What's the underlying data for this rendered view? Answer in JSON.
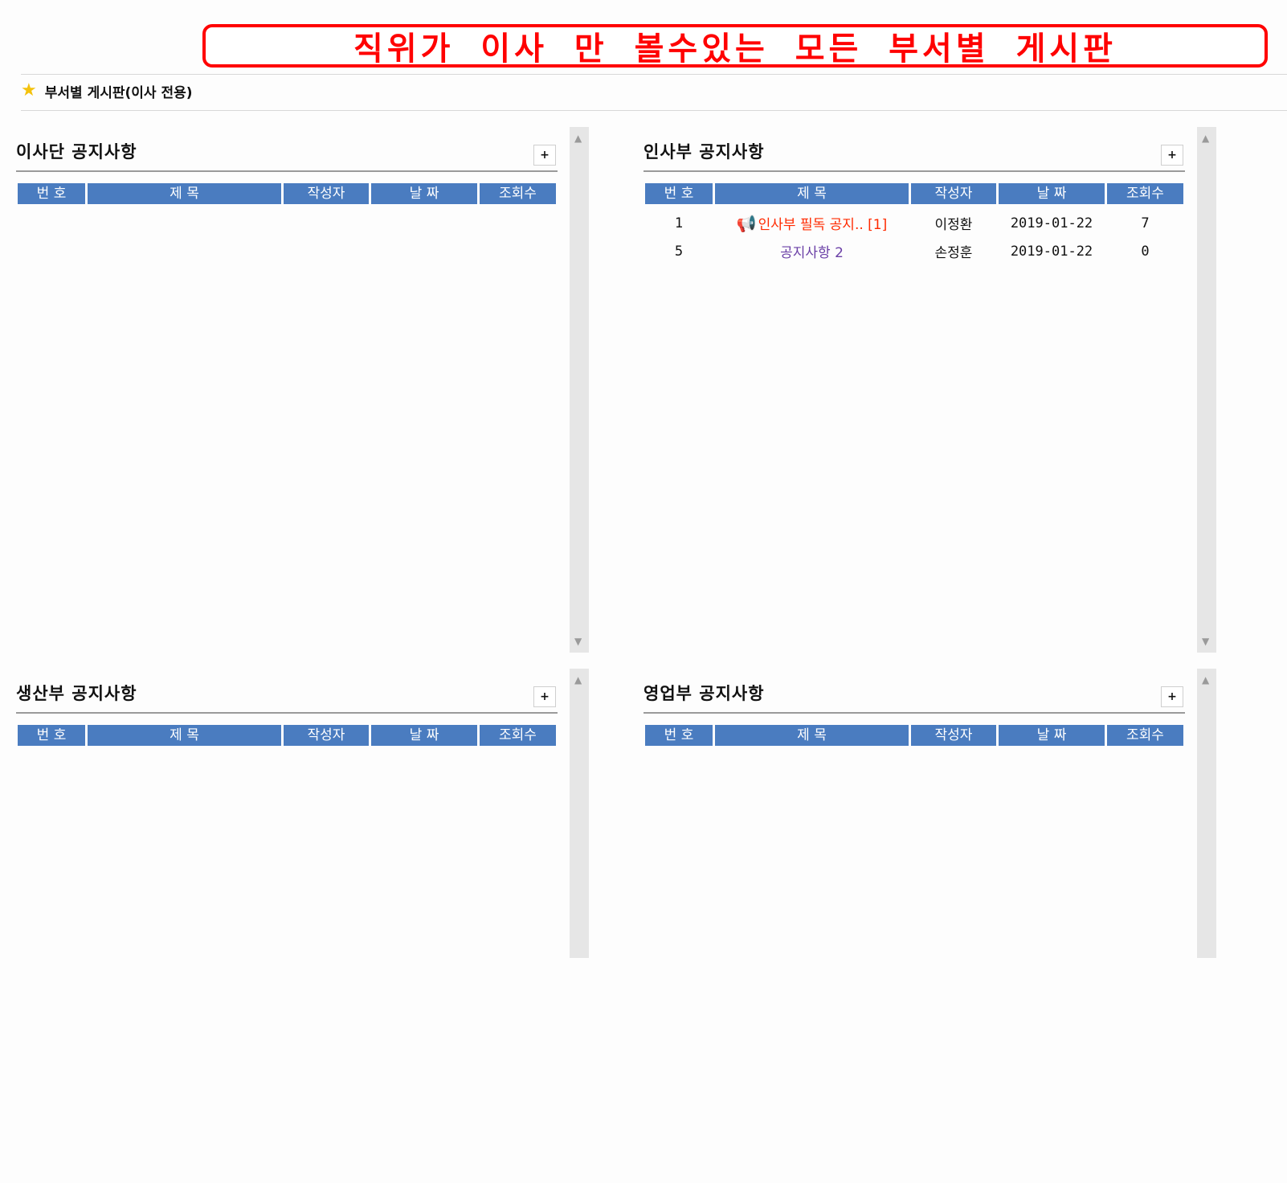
{
  "banner": {
    "text": "직위가 이사 만 볼수있는 모든 부서별 게시판"
  },
  "breadcrumb": {
    "title": "부서별 게시판(이사 전용)"
  },
  "table_headers": [
    "번 호",
    "제 목",
    "작성자",
    "날 짜",
    "조회수"
  ],
  "more_button": "+",
  "panels": [
    {
      "title": "이사단 공지사항",
      "rows": []
    },
    {
      "title": "인사부 공지사항",
      "rows": [
        {
          "no": "1",
          "subject": "인사부 필독 공지.. [1]",
          "author": "이정환",
          "date": "2019-01-22",
          "views": "7",
          "notice": true
        },
        {
          "no": "5",
          "subject": "공지사항 2",
          "author": "손정훈",
          "date": "2019-01-22",
          "views": "0",
          "notice": false
        }
      ]
    },
    {
      "title": "생산부 공지사항",
      "rows": []
    },
    {
      "title": "영업부 공지사항",
      "rows": []
    }
  ],
  "colors": {
    "header_bg": "#4a7cc0",
    "banner_red": "#ff0000",
    "notice_red": "#ff2a00",
    "link_purple": "#6a3fa6",
    "star": "#f4c20d"
  },
  "icons": {
    "breadcrumb": "star-icon",
    "notice": "megaphone-icon",
    "scroll_up": "arrow-up-icon",
    "scroll_down": "arrow-down-icon"
  }
}
